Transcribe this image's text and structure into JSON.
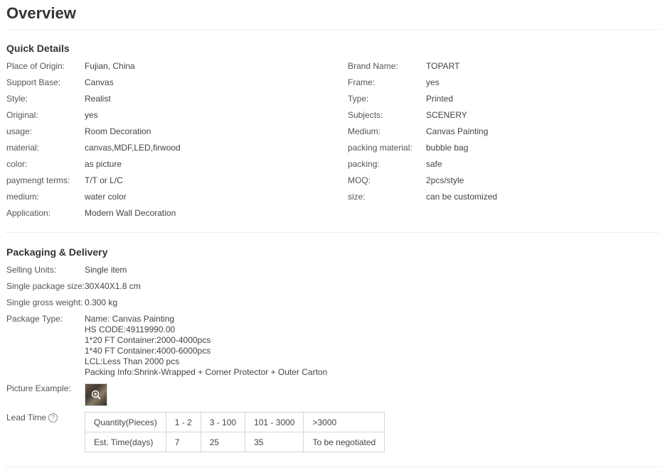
{
  "page_title": "Overview",
  "quick_details": {
    "title": "Quick Details",
    "left": [
      {
        "label": "Place of Origin:",
        "value": "Fujian, China"
      },
      {
        "label": "Support Base:",
        "value": "Canvas"
      },
      {
        "label": "Style:",
        "value": "Realist"
      },
      {
        "label": "Original:",
        "value": "yes"
      },
      {
        "label": "usage:",
        "value": "Room Decoration"
      },
      {
        "label": "material:",
        "value": "canvas,MDF,LED,firwood"
      },
      {
        "label": "color:",
        "value": "as picture"
      },
      {
        "label": "paymengt terms:",
        "value": "T/T or L/C"
      },
      {
        "label": "medium:",
        "value": "water color"
      },
      {
        "label": "Application:",
        "value": "Modern Wall Decoration"
      }
    ],
    "right": [
      {
        "label": "Brand Name:",
        "value": "TOPART"
      },
      {
        "label": "Frame:",
        "value": "yes"
      },
      {
        "label": "Type:",
        "value": "Printed"
      },
      {
        "label": "Subjects:",
        "value": "SCENERY"
      },
      {
        "label": "Medium:",
        "value": "Canvas Painting"
      },
      {
        "label": "packing material:",
        "value": "bubble bag"
      },
      {
        "label": "packing:",
        "value": "safe"
      },
      {
        "label": "MOQ:",
        "value": "2pcs/style"
      },
      {
        "label": "size:",
        "value": "can be customized"
      }
    ]
  },
  "packaging": {
    "title": "Packaging & Delivery",
    "selling_units": {
      "label": "Selling Units:",
      "value": "Single item"
    },
    "package_size": {
      "label": "Single package size:",
      "value": "30X40X1.8 cm"
    },
    "gross_weight": {
      "label": "Single gross weight:",
      "value": "0.300 kg"
    },
    "package_type": {
      "label": "Package Type:",
      "lines": [
        "Name: Canvas Painting",
        "HS CODE:49119990.00",
        "1*20 FT Container:2000-4000pcs",
        "1*40 FT Container:4000-6000pcs",
        "LCL:Less Than 2000 pcs",
        "Packing Info:Shrink-Wrapped + Corner Protector + Outer Carton"
      ]
    },
    "picture_example_label": "Picture Example:",
    "lead_time": {
      "label": "Lead Time",
      "help_glyph": "?",
      "rows": [
        [
          "Quantity(Pieces)",
          "1 - 2",
          "3 - 100",
          "101 - 3000",
          ">3000"
        ],
        [
          "Est. Time(days)",
          "7",
          "25",
          "35",
          "To be negotiated"
        ]
      ]
    }
  },
  "icons": {
    "thumbnail_overlay": "zoom-in-icon",
    "lead_time_help": "question-circle-icon"
  }
}
